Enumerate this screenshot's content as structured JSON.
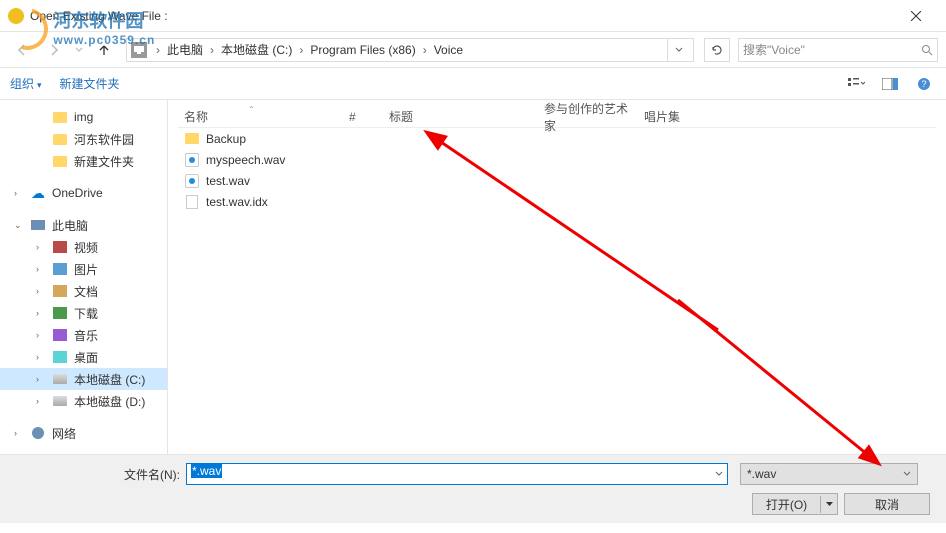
{
  "window": {
    "title": "Open Existing Wave File :"
  },
  "breadcrumb": {
    "items": [
      "此电脑",
      "本地磁盘 (C:)",
      "Program Files (x86)",
      "Voice"
    ]
  },
  "search": {
    "placeholder": "搜索\"Voice\""
  },
  "toolbar": {
    "organize": "组织",
    "new_folder": "新建文件夹"
  },
  "tree": {
    "groups": [
      {
        "items": [
          {
            "icon": "folder",
            "label": "img",
            "indent": true
          },
          {
            "icon": "folder",
            "label": "河东软件园",
            "indent": true
          },
          {
            "icon": "folder",
            "label": "新建文件夹",
            "indent": true
          }
        ]
      },
      {
        "items": [
          {
            "icon": "cloud",
            "label": "OneDrive",
            "top": true,
            "exp": "›"
          }
        ]
      },
      {
        "items": [
          {
            "icon": "pc",
            "label": "此电脑",
            "top": true,
            "exp": "⌄"
          },
          {
            "icon": "lib-video",
            "label": "视频",
            "indent": true,
            "exp": "›"
          },
          {
            "icon": "lib-pic",
            "label": "图片",
            "indent": true,
            "exp": "›"
          },
          {
            "icon": "lib-doc",
            "label": "文档",
            "indent": true,
            "exp": "›"
          },
          {
            "icon": "lib-dl",
            "label": "下载",
            "indent": true,
            "exp": "›"
          },
          {
            "icon": "lib-music",
            "label": "音乐",
            "indent": true,
            "exp": "›"
          },
          {
            "icon": "lib-desk",
            "label": "桌面",
            "indent": true,
            "exp": "›"
          },
          {
            "icon": "drive",
            "label": "本地磁盘 (C:)",
            "indent": true,
            "exp": "›",
            "selected": true
          },
          {
            "icon": "drive",
            "label": "本地磁盘 (D:)",
            "indent": true,
            "exp": "›"
          }
        ]
      },
      {
        "items": [
          {
            "icon": "net",
            "label": "网络",
            "top": true,
            "exp": "›"
          }
        ]
      }
    ]
  },
  "columns": {
    "name": "名称",
    "num": "#",
    "title": "标题",
    "artist": "参与创作的艺术家",
    "album": "唱片集"
  },
  "files": [
    {
      "icon": "folder",
      "name": "Backup"
    },
    {
      "icon": "wav",
      "name": "myspeech.wav"
    },
    {
      "icon": "wav",
      "name": "test.wav"
    },
    {
      "icon": "txt",
      "name": "test.wav.idx"
    }
  ],
  "footer": {
    "filename_label": "文件名(N):",
    "filename_value": "*.wav",
    "filter": "*.wav",
    "open": "打开(O)",
    "cancel": "取消"
  },
  "watermark": {
    "main": "河东软件园",
    "sub": "www.pc0359.cn"
  }
}
